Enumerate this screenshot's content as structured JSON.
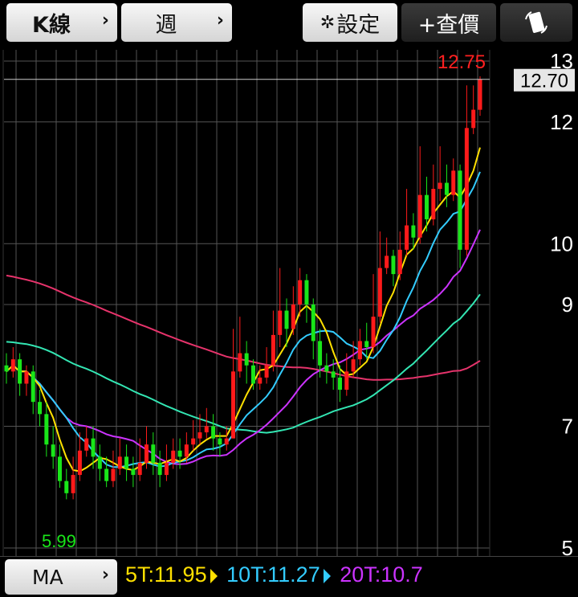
{
  "toolbar": {
    "kline_label": "K線",
    "period_label": "週",
    "settings_label": "設定",
    "addprice_label": "+查價"
  },
  "ma": {
    "button_label": "MA",
    "items": [
      {
        "label": "5T:11.95",
        "color": "#ffe000"
      },
      {
        "label": "10T:11.27",
        "color": "#33ccff"
      },
      {
        "label": "20T:10.7",
        "color": "#cc33ff"
      }
    ]
  },
  "colors": {
    "up": "#ff1a1a",
    "down": "#19e619",
    "ma5": "#ffe000",
    "ma10": "#33ccff",
    "ma20": "#cc33ff",
    "ma_long1": "#33e6b3",
    "ma_long2": "#e6336b",
    "grid": "#555555",
    "price_line": "#cccccc"
  },
  "chart_data": {
    "type": "candlestick",
    "period": "週",
    "ylim": [
      5,
      13
    ],
    "y_ticks": [
      "13",
      "12",
      "10",
      "9",
      "7",
      "5"
    ],
    "y_tick_values": [
      13,
      12,
      10,
      9,
      7,
      5
    ],
    "current_price": "12.70",
    "current_price_value": 12.7,
    "high_label": "12.75",
    "high_value": 12.75,
    "low_label": "5.99",
    "low_value": 5.99,
    "candles": [
      [
        8.0,
        7.9,
        8.2,
        7.7
      ],
      [
        7.9,
        8.1,
        8.3,
        7.8
      ],
      [
        8.1,
        7.7,
        8.2,
        7.5
      ],
      [
        7.7,
        7.9,
        8.0,
        7.5
      ],
      [
        7.9,
        7.4,
        8.0,
        7.2
      ],
      [
        7.4,
        7.2,
        7.6,
        7.0
      ],
      [
        7.2,
        6.7,
        7.4,
        6.5
      ],
      [
        6.7,
        6.5,
        7.0,
        6.3
      ],
      [
        6.5,
        6.1,
        6.7,
        5.99
      ],
      [
        6.1,
        5.9,
        6.3,
        5.8
      ],
      [
        5.9,
        6.2,
        6.5,
        5.8
      ],
      [
        6.2,
        6.6,
        6.9,
        6.1
      ],
      [
        6.6,
        6.8,
        7.0,
        6.5
      ],
      [
        6.8,
        6.5,
        7.0,
        6.3
      ],
      [
        6.5,
        6.3,
        6.7,
        6.1
      ],
      [
        6.3,
        6.1,
        6.5,
        6.0
      ],
      [
        6.1,
        6.3,
        6.6,
        6.0
      ],
      [
        6.3,
        6.5,
        6.8,
        6.2
      ],
      [
        6.5,
        6.3,
        6.7,
        6.1
      ],
      [
        6.3,
        6.2,
        6.5,
        6.0
      ],
      [
        6.2,
        6.4,
        6.8,
        6.1
      ],
      [
        6.4,
        6.7,
        7.0,
        6.3
      ],
      [
        6.7,
        6.4,
        6.9,
        6.2
      ],
      [
        6.4,
        6.2,
        6.6,
        6.0
      ],
      [
        6.2,
        6.4,
        6.7,
        6.1
      ],
      [
        6.4,
        6.6,
        6.8,
        6.3
      ],
      [
        6.6,
        6.5,
        6.8,
        6.3
      ],
      [
        6.5,
        6.7,
        6.9,
        6.4
      ],
      [
        6.7,
        6.8,
        7.1,
        6.6
      ],
      [
        6.8,
        6.9,
        7.2,
        6.7
      ],
      [
        6.9,
        7.0,
        7.3,
        6.8
      ],
      [
        7.0,
        6.8,
        7.2,
        6.6
      ],
      [
        6.8,
        6.7,
        6.9,
        6.5
      ],
      [
        6.7,
        6.8,
        7.0,
        6.6
      ],
      [
        6.8,
        7.9,
        8.6,
        6.8
      ],
      [
        7.9,
        8.2,
        8.8,
        7.8
      ],
      [
        8.2,
        8.0,
        8.4,
        7.7
      ],
      [
        8.0,
        7.7,
        8.1,
        7.6
      ],
      [
        7.7,
        7.8,
        8.0,
        7.6
      ],
      [
        7.8,
        8.0,
        8.3,
        7.7
      ],
      [
        8.0,
        8.5,
        8.9,
        7.9
      ],
      [
        8.5,
        8.9,
        9.6,
        8.3
      ],
      [
        8.9,
        8.6,
        9.1,
        8.3
      ],
      [
        8.6,
        9.0,
        9.3,
        8.5
      ],
      [
        9.0,
        9.4,
        9.6,
        8.8
      ],
      [
        9.4,
        9.0,
        9.5,
        8.7
      ],
      [
        9.0,
        8.4,
        9.1,
        8.1
      ],
      [
        8.4,
        8.0,
        8.6,
        7.8
      ],
      [
        8.0,
        7.9,
        8.2,
        7.7
      ],
      [
        7.9,
        7.8,
        8.1,
        7.6
      ],
      [
        7.8,
        7.6,
        8.0,
        7.4
      ],
      [
        7.6,
        7.9,
        8.2,
        7.5
      ],
      [
        7.9,
        8.1,
        8.4,
        7.8
      ],
      [
        8.1,
        8.4,
        8.6,
        8.0
      ],
      [
        8.4,
        8.3,
        8.7,
        8.1
      ],
      [
        8.3,
        8.8,
        9.5,
        8.2
      ],
      [
        8.8,
        9.6,
        10.2,
        8.7
      ],
      [
        9.6,
        9.8,
        10.1,
        9.5
      ],
      [
        9.8,
        9.5,
        9.9,
        9.3
      ],
      [
        9.5,
        9.9,
        10.2,
        9.4
      ],
      [
        9.9,
        10.3,
        10.9,
        9.8
      ],
      [
        10.3,
        10.1,
        10.5,
        9.9
      ],
      [
        10.1,
        10.8,
        11.6,
        10.0
      ],
      [
        10.8,
        10.4,
        11.1,
        10.2
      ],
      [
        10.4,
        10.9,
        11.3,
        10.3
      ],
      [
        10.9,
        11.0,
        11.6,
        10.7
      ],
      [
        11.0,
        10.8,
        11.3,
        10.6
      ],
      [
        10.8,
        11.2,
        11.4,
        10.7
      ],
      [
        11.2,
        9.9,
        11.3,
        9.6
      ],
      [
        9.9,
        11.9,
        12.6,
        9.8
      ],
      [
        11.9,
        12.2,
        12.6,
        11.8
      ],
      [
        12.2,
        12.7,
        12.75,
        12.1
      ]
    ]
  }
}
